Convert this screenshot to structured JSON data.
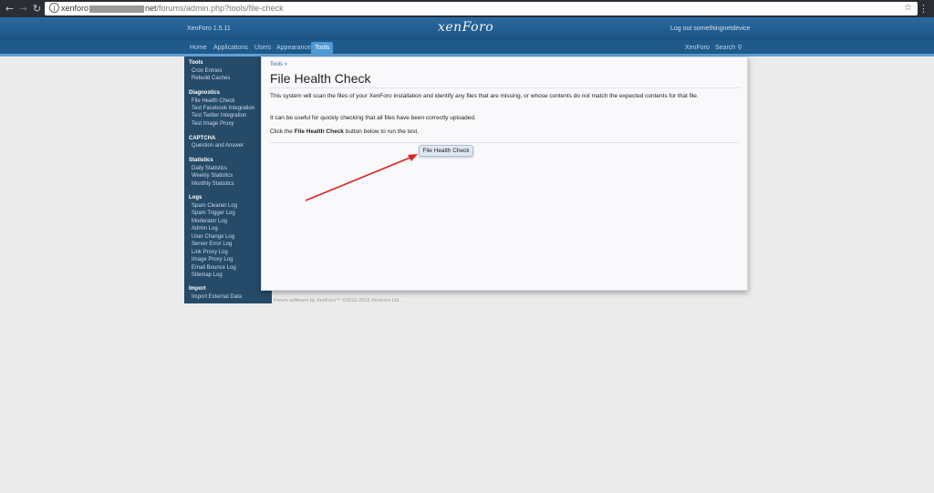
{
  "browser": {
    "url_prefix": "xenforo",
    "url_domain_end": "net",
    "url_path": "/forums/admin.php?tools/file-check"
  },
  "header": {
    "version": "XenForo 1.5.11",
    "logo": "xenForo",
    "logout": "Log out somethingnetdevice"
  },
  "tabs": [
    "Home",
    "Applications",
    "Users",
    "Appearance",
    "Tools"
  ],
  "tabs_right": {
    "xenforo": "XenForo",
    "search": "Search"
  },
  "sidebar": {
    "sections": [
      {
        "title": "Tools",
        "items": [
          "Cron Entries",
          "Rebuild Caches"
        ]
      },
      {
        "title": "Diagnostics",
        "items": [
          "File Health Check",
          "Test Facebook Integration",
          "Test Twitter Integration",
          "Test Image Proxy"
        ]
      },
      {
        "title": "CAPTCHA",
        "items": [
          "Question and Answer"
        ]
      },
      {
        "title": "Statistics",
        "items": [
          "Daily Statistics",
          "Weekly Statistics",
          "Monthly Statistics"
        ]
      },
      {
        "title": "Logs",
        "items": [
          "Spam Cleaner Log",
          "Spam Trigger Log",
          "Moderator Log",
          "Admin Log",
          "User Change Log",
          "Server Error Log",
          "Link Proxy Log",
          "Image Proxy Log",
          "Email Bounce Log",
          "Sitemap Log"
        ]
      },
      {
        "title": "Import",
        "items": [
          "Import External Data"
        ]
      }
    ]
  },
  "main": {
    "breadcrumb": "Tools »",
    "title": "File Health Check",
    "para1": "This system will scan the files of your XenForo installation and identify any files that are missing, or whose contents do not match the expected contents for that file.",
    "para2": "It can be useful for quickly checking that all files have been correctly uploaded.",
    "para3_pre": "Click the ",
    "para3_bold": "File Health Check",
    "para3_post": " button below to run the test.",
    "button": "File Health Check"
  },
  "footer": "Forum software by XenForo™ ©2010-2016 XenForo Ltd.",
  "colors": {
    "header": "#1f5a8a",
    "sidebar": "#264b69",
    "active_tab": "#4d9ad6",
    "arrow": "#e02020"
  }
}
